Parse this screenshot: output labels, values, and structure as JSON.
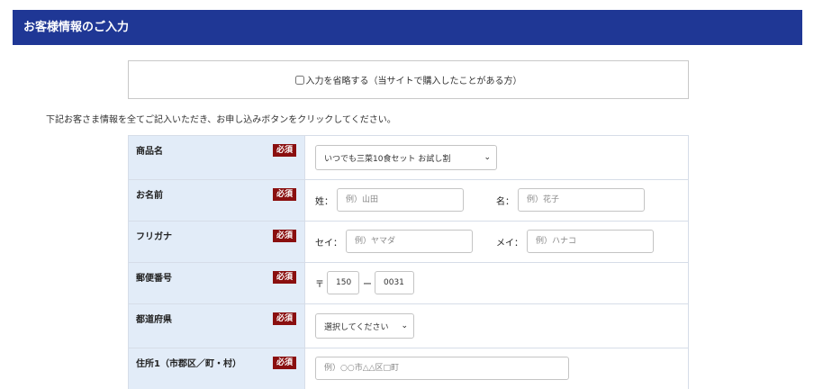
{
  "header": {
    "title": "お客様情報のご入力"
  },
  "skip": {
    "label": "入力を省略する（当サイトで購入したことがある方）"
  },
  "intro": {
    "text": "下記お客さま情報を全てご記入いただき、お申し込みボタンをクリックしてください。"
  },
  "required_badge": "必須",
  "rows": {
    "product": {
      "label": "商品名",
      "selected": "いつでも三菜10食セット お試し割"
    },
    "name": {
      "label": "お名前",
      "last_label": "姓：",
      "last_placeholder": "例）山田",
      "first_label": "名：",
      "first_placeholder": "例）花子"
    },
    "kana": {
      "label": "フリガナ",
      "last_label": "セイ：",
      "last_placeholder": "例）ヤマダ",
      "first_label": "メイ：",
      "first_placeholder": "例）ハナコ"
    },
    "postal": {
      "label": "郵便番号",
      "mark": "〒",
      "first_value": "150",
      "dash": "ー",
      "second_value": "0031"
    },
    "prefecture": {
      "label": "都道府県",
      "selected": "選択してください"
    },
    "address1": {
      "label": "住所1（市郡区／町・村）",
      "placeholder": "例）○○市△△区□町"
    }
  },
  "colors": {
    "header_bg": "#1f3795",
    "label_bg": "#e2ecf8",
    "required_bg": "#8a0f0f"
  },
  "icons": {
    "select_arrow": "chevron-down-icon"
  }
}
